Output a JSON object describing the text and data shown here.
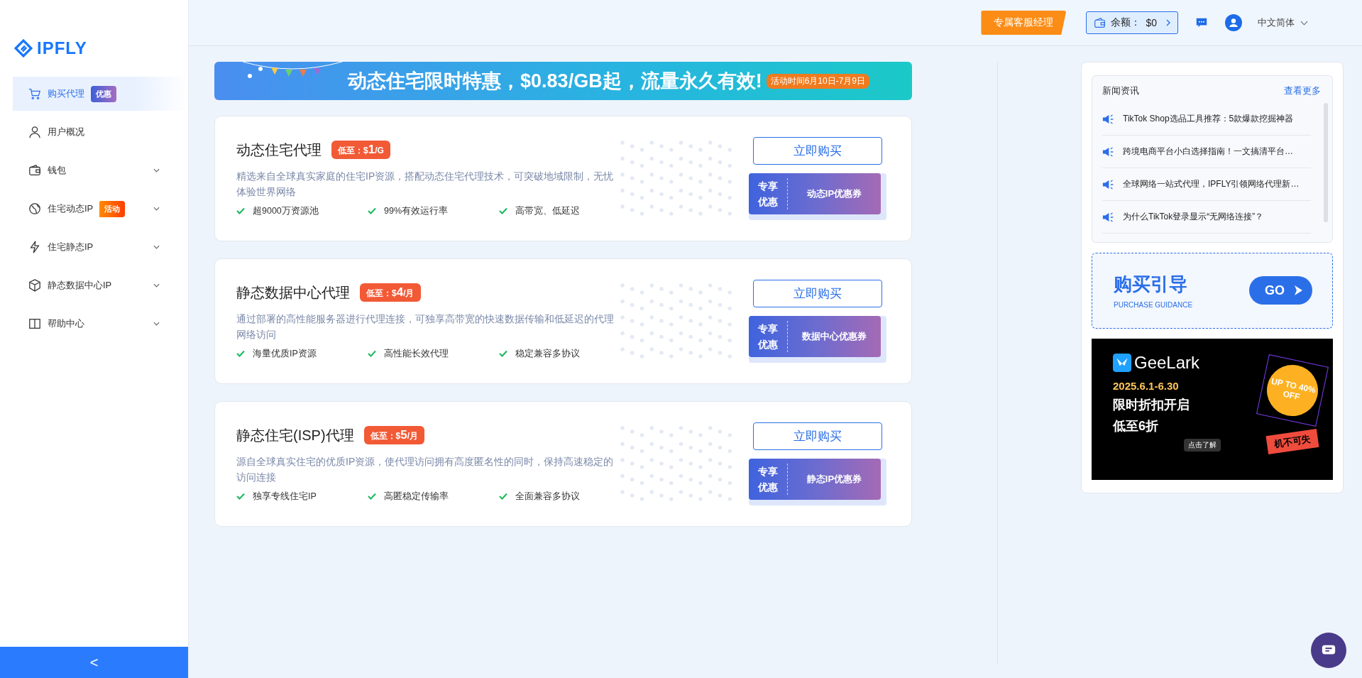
{
  "logo": {
    "text": "IPFLY"
  },
  "sidebar": {
    "items": [
      {
        "label": "购买代理",
        "selected": true,
        "expandable": false,
        "badge": {
          "text": "优惠",
          "kind": "promo"
        }
      },
      {
        "label": "用户概况",
        "selected": false,
        "expandable": false
      },
      {
        "label": "钱包",
        "selected": false,
        "expandable": true
      },
      {
        "label": "住宅动态IP",
        "selected": false,
        "expandable": true,
        "badge": {
          "text": "活动",
          "kind": "event"
        }
      },
      {
        "label": "住宅静态IP",
        "selected": false,
        "expandable": true
      },
      {
        "label": "静态数据中心IP",
        "selected": false,
        "expandable": true
      },
      {
        "label": "帮助中心",
        "selected": false,
        "expandable": true
      }
    ],
    "collapse_label": "<"
  },
  "topbar": {
    "manager_button": "专属客服经理",
    "balance": {
      "label": "余额：",
      "value": "$0"
    },
    "language": "中文简体"
  },
  "banner": {
    "headline": "动态住宅限时特惠，$0.83/GB起，流量永久有效!",
    "period": "活动时间6月10日-7月9日"
  },
  "products": [
    {
      "title": "动态住宅代理",
      "price": {
        "prefix": "低至：",
        "currency": "$",
        "amount": "1",
        "unit": "/G"
      },
      "description": "精选来自全球真实家庭的住宅IP资源，搭配动态住宅代理技术，可突破地域限制，无忧体验世界网络",
      "features": [
        "超9000万资源池",
        "99%有效运行率",
        "高带宽、低延迟"
      ],
      "buy_button": "立即购买",
      "coupon": {
        "tag": "专享优惠",
        "name": "动态IP优惠券"
      }
    },
    {
      "title": "静态数据中心代理",
      "price": {
        "prefix": "低至：",
        "currency": "$",
        "amount": "4",
        "unit": "/月"
      },
      "description": "通过部署的高性能服务器进行代理连接，可独享高带宽的快速数据传输和低延迟的代理网络访问",
      "features": [
        "海量优质IP资源",
        "高性能长效代理",
        "稳定兼容多协议"
      ],
      "buy_button": "立即购买",
      "coupon": {
        "tag": "专享优惠",
        "name": "数据中心优惠券"
      }
    },
    {
      "title": "静态住宅(ISP)代理",
      "price": {
        "prefix": "低至：",
        "currency": "$",
        "amount": "5",
        "unit": "/月"
      },
      "description": "源自全球真实住宅的优质IP资源，使代理访问拥有高度匿名性的同时，保持高速稳定的访问连接",
      "features": [
        "独享专线住宅IP",
        "高匿稳定传输率",
        "全面兼容多协议"
      ],
      "buy_button": "立即购买",
      "coupon": {
        "tag": "专享优惠",
        "name": "静态IP优惠券"
      }
    }
  ],
  "news": {
    "title": "新闻资讯",
    "more_link": "查看更多",
    "items": [
      "TikTok Shop选品工具推荐：5款爆款挖掘神器",
      "跨境电商平台小白选择指南！一文搞清平台…",
      "全球网络一站式代理，IPFLY引领网络代理新…",
      "为什么TikTok登录显示“无网络连接”？"
    ]
  },
  "guide": {
    "title": "购买引导",
    "subtitle": "PURCHASE GUIDANCE",
    "go_button": "GO"
  },
  "ad": {
    "brand": "GeeLark",
    "dates": "2025.6.1-6.30",
    "line1": "限时折扣开启",
    "line2": "低至6折",
    "burst": "UP TO 40% OFF",
    "tag": "机不可失",
    "cta": "点击了解"
  }
}
